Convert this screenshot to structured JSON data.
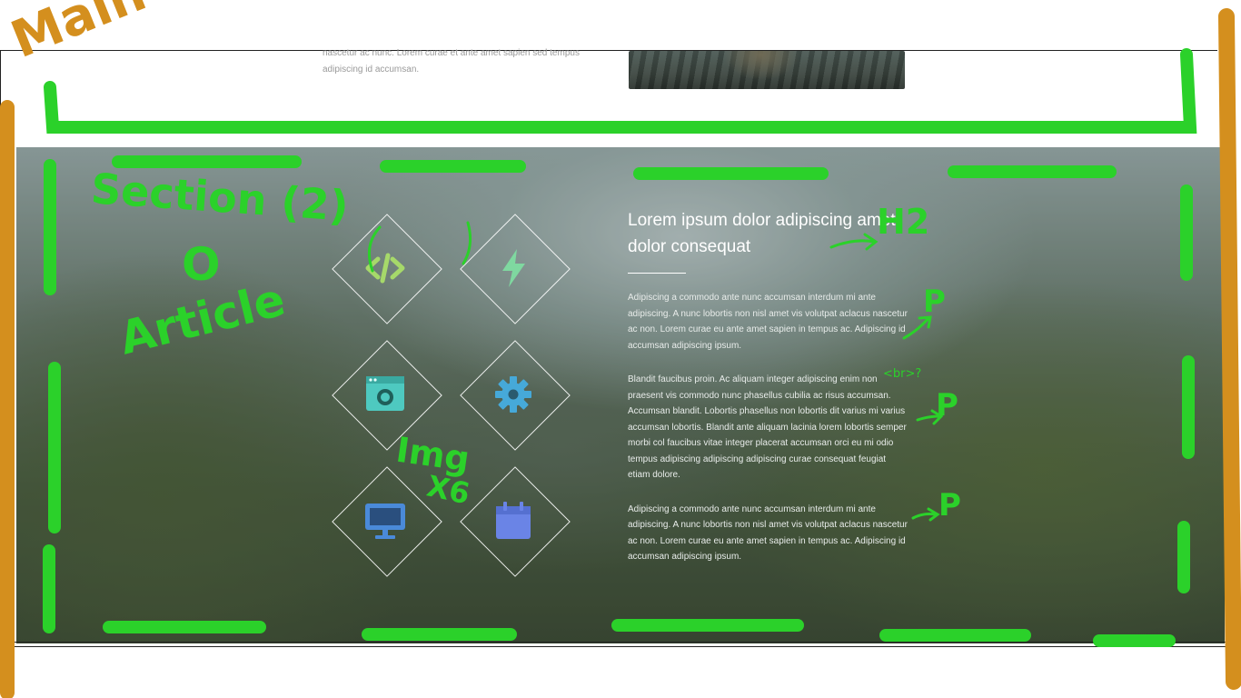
{
  "top_section": {
    "text": "nascetur ac nunc. Lorem curae et ante amet sapien sed tempus adipiscing id accumsan."
  },
  "article": {
    "heading": "Lorem ipsum dolor adipiscing amet dolor consequat",
    "paragraphs": [
      "Adipiscing a commodo ante nunc accumsan interdum mi ante adipiscing. A nunc lobortis non nisl amet vis volutpat aclacus nascetur ac non. Lorem curae eu ante amet sapien in tempus ac. Adipiscing id accumsan adipiscing ipsum.",
      "Blandit faucibus proin. Ac aliquam integer adipiscing enim non praesent vis commodo nunc phasellus cubilia ac risus accumsan. Accumsan blandit. Lobortis phasellus non lobortis dit varius mi varius accumsan lobortis. Blandit ante aliquam lacinia lorem lobortis semper morbi col faucibus vitae integer placerat accumsan orci eu mi odio tempus adipiscing adipiscing adipiscing curae consequat feugiat etiam dolore.",
      "Adipiscing a commodo ante nunc accumsan interdum mi ante adipiscing. A nunc lobortis non nisl amet vis volutpat aclacus nascetur ac non. Lorem curae eu ante amet sapien in tempus ac. Adipiscing id accumsan adipiscing ipsum."
    ]
  },
  "tiles": [
    {
      "icon": "code-icon",
      "color": "#a6d96a"
    },
    {
      "icon": "bolt-icon",
      "color": "#7fd8a0"
    },
    {
      "icon": "camera-window-icon",
      "color": "#4ec9c0"
    },
    {
      "icon": "gear-icon",
      "color": "#46a9d9"
    },
    {
      "icon": "desktop-icon",
      "color": "#4a8ad9"
    },
    {
      "icon": "calendar-icon",
      "color": "#6a84e6"
    }
  ],
  "annotations": {
    "main": "Main",
    "section": "Section (2)",
    "o": "O",
    "article": "Article",
    "h2": "H2",
    "p1": "P",
    "br": "<br>?",
    "p2": "P",
    "p3": "P",
    "img": "Img",
    "x6": "X6",
    "colors": {
      "main_frame": "#d48f1e",
      "section_frame": "#2bd12a"
    }
  }
}
